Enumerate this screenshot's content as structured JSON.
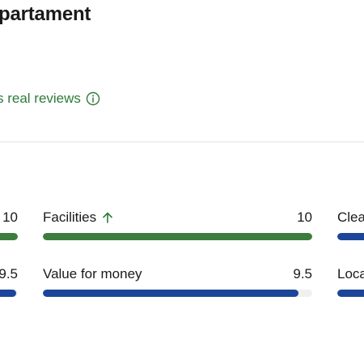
{
  "header": {
    "title": "partament"
  },
  "reviews": {
    "link_text": "s real reviews",
    "info_icon": "info-icon"
  },
  "scores": {
    "row1": {
      "left_partial": {
        "value": "10",
        "fill": 1.0,
        "color": "#3b7d3c"
      },
      "facilities": {
        "label": "Facilities",
        "value": "10",
        "fill": 1.0,
        "trend_icon": "arrow-up-icon",
        "color": "#3b7d3c"
      },
      "right_partial": {
        "label": "Clea",
        "fill": 1.0,
        "color": "#1a4599"
      }
    },
    "row2": {
      "left_partial": {
        "value": "9.5",
        "fill": 0.95,
        "color": "#1a4599"
      },
      "value_for_money": {
        "label": "Value for money",
        "value": "9.5",
        "fill": 0.95,
        "color": "#1a4599"
      },
      "right_partial": {
        "label": "Loca",
        "fill": 1.0,
        "color": "#1a4599"
      }
    }
  }
}
